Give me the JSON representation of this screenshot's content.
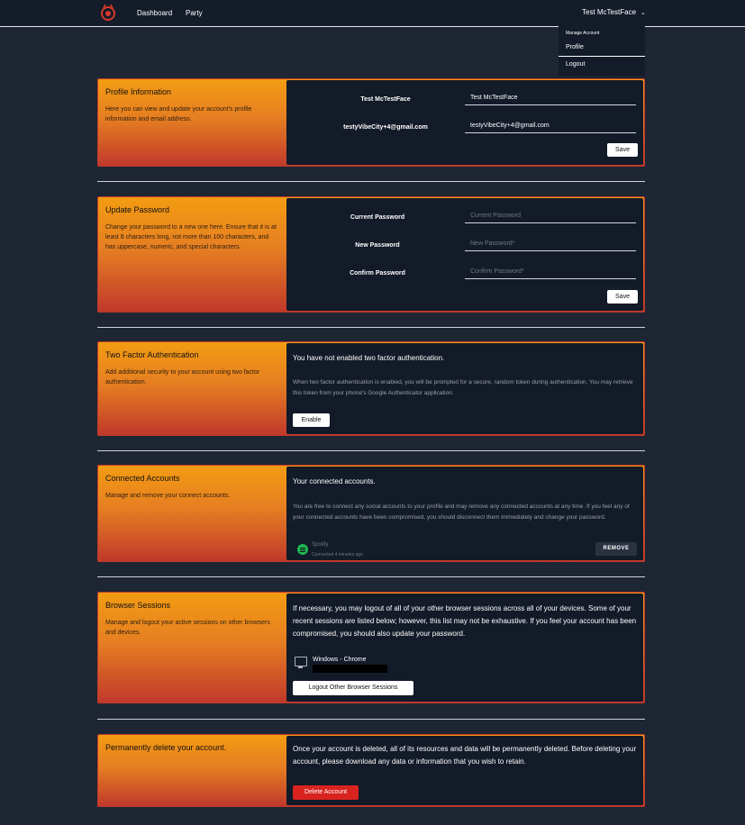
{
  "nav": {
    "links": [
      "Dashboard",
      "Party"
    ],
    "user_name": "Test McTestFace",
    "chevron": "chevron-down-icon"
  },
  "dropdown": {
    "header": "Manage Account",
    "items": [
      "Profile",
      "Logout"
    ]
  },
  "profile": {
    "title": "Profile Information",
    "description": "Here you can view and update your account's profile information and email address.",
    "name_label": "Test McTestFace",
    "name_value": "Test McTestFace",
    "email_label": "testyVibeCity+4@gmail.com",
    "email_value": "testyVibeCity+4@gmail.com",
    "save_label": "Save"
  },
  "password": {
    "title": "Update Password",
    "description": "Change your password to a new one here. Ensure that it is at least 8 characters long, not more than 100 characters, and has uppercase, numeric, and special characters.",
    "current_label": "Current Password",
    "current_placeholder": "Current Password",
    "new_label": "New Password",
    "new_placeholder": "New Password*",
    "confirm_label": "Confirm Password",
    "confirm_placeholder": "Confirm Password*",
    "save_label": "Save"
  },
  "two_factor": {
    "title": "Two Factor Authentication",
    "description": "Add additional security to your account using two factor authentication.",
    "heading": "You have not enabled two factor authentication.",
    "body": "When two factor authentication is enabled, you will be prompted for a secure, random token during authentication. You may retrieve this token from your phone's Google Authenticator application.",
    "enable_label": "Enable"
  },
  "connected": {
    "title": "Connected Accounts",
    "description": "Manage and remove your connect accounts.",
    "heading": "Your connected accounts.",
    "body": "You are free to connect any social accounts to your profile and may remove any connected accounts at any time. If you feel any of your connected accounts have been compromised, you should disconnect them immediately and change your password.",
    "account_name": "Spotify",
    "account_meta": "Connected 4 minutes ago",
    "remove_label": "REMOVE",
    "icon": "spotify-icon"
  },
  "sessions": {
    "title": "Browser Sessions",
    "description": "Manage and logout your active sessions on other browsers and devices.",
    "body": "If necessary, you may logout of all of your other browser sessions across all of your devices. Some of your recent sessions are listed below; however, this list may not be exhaustive. If you feel your account has been compromised, you should also update your password.",
    "session_name": "Windows - Chrome",
    "logout_label": "Logout Other Browser Sessions",
    "icon": "monitor-icon"
  },
  "delete": {
    "title": "Permanently delete your account.",
    "body": "Once your account is deleted, all of its resources and data will be permanently deleted. Before deleting your account, please download any data or information that you wish to retain.",
    "delete_label": "Delete Account"
  },
  "colors": {
    "accent_top": "#f39c12",
    "accent_bottom": "#c0392b",
    "panel": "#131a28",
    "page_bg": "#1f2633",
    "danger": "#d9231f"
  }
}
